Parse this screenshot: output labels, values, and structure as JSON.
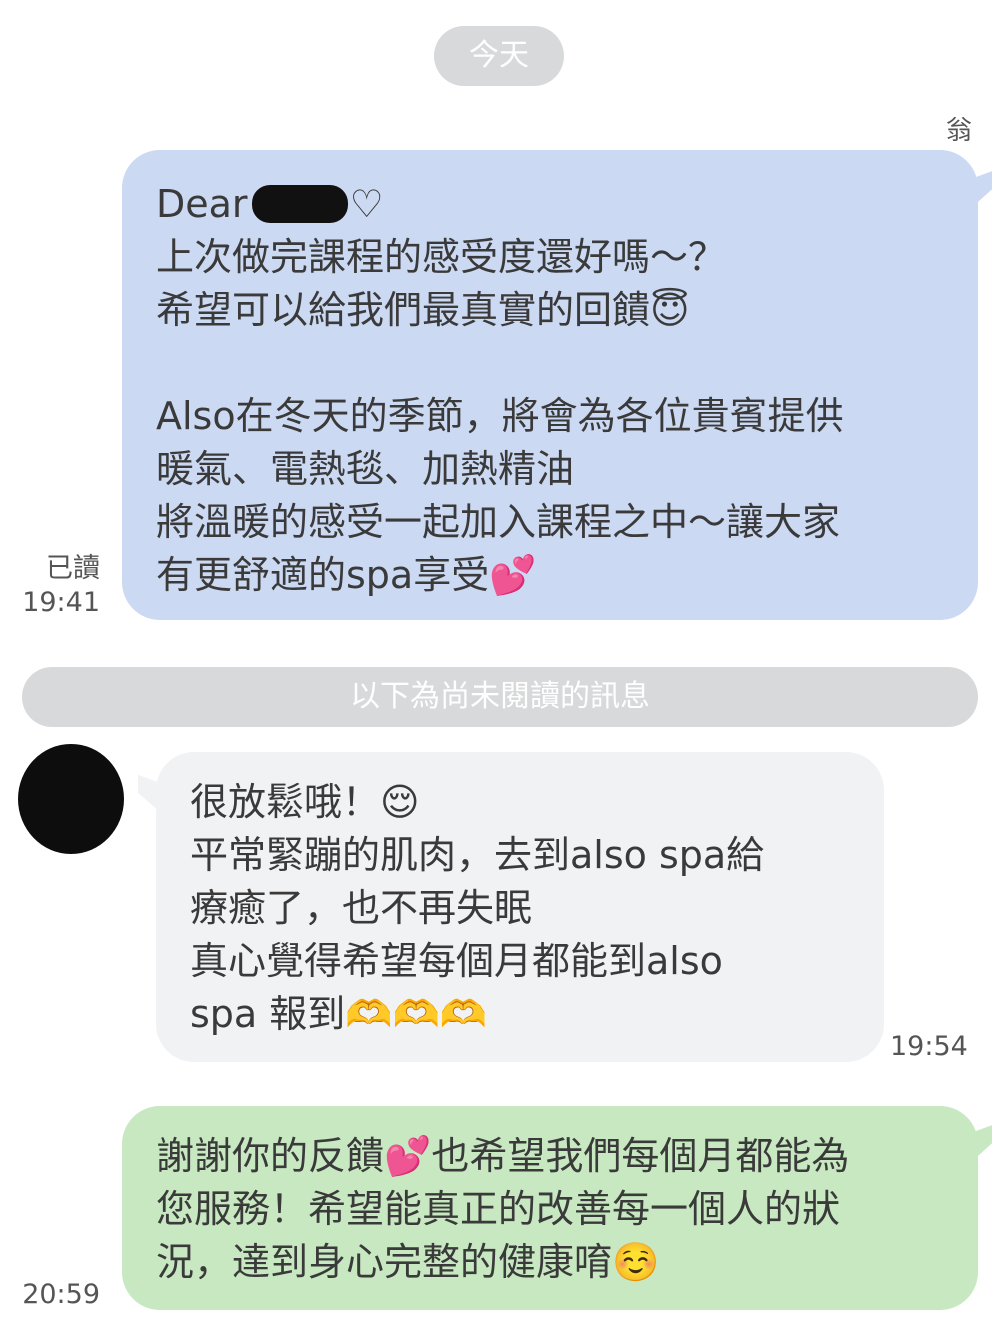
{
  "date_divider": "今天",
  "sender_name": "翁",
  "unread_divider": "以下為尚未閱讀的訊息",
  "messages": [
    {
      "lines": [
        "Dear",
        "上次做完課程的感受度還好嗎～？",
        "希望可以給我們最真實的回饋😇",
        "",
        "Also在冬天的季節，將會為各位貴賓提供",
        "暖氣、電熱毯、加熱精油",
        "將溫暖的感受一起加入課程之中～讓大家",
        "有更舒適的spa享受💕"
      ],
      "heart": "♡",
      "read_label": "已讀",
      "time": "19:41"
    },
    {
      "lines": [
        "很放鬆哦！😌",
        "平常緊蹦的肌肉，去到also spa給",
        "療癒了，也不再失眠",
        "真心覺得希望每個月都能到also",
        "spa 報到🫶🫶🫶"
      ],
      "time": "19:54"
    },
    {
      "lines": [
        "謝謝你的反饋💕也希望我們每個月都能為",
        "您服務！希望能真正的改善每一個人的狀",
        "況，達到身心完整的健康唷☺️"
      ],
      "time": "20:59"
    }
  ],
  "colors": {
    "outgoing_bubble": "#ccd9f3",
    "incoming_bubble": "#f1f2f4",
    "reply_bubble": "#c7e8c1",
    "divider_pill": "#d8d9da"
  }
}
